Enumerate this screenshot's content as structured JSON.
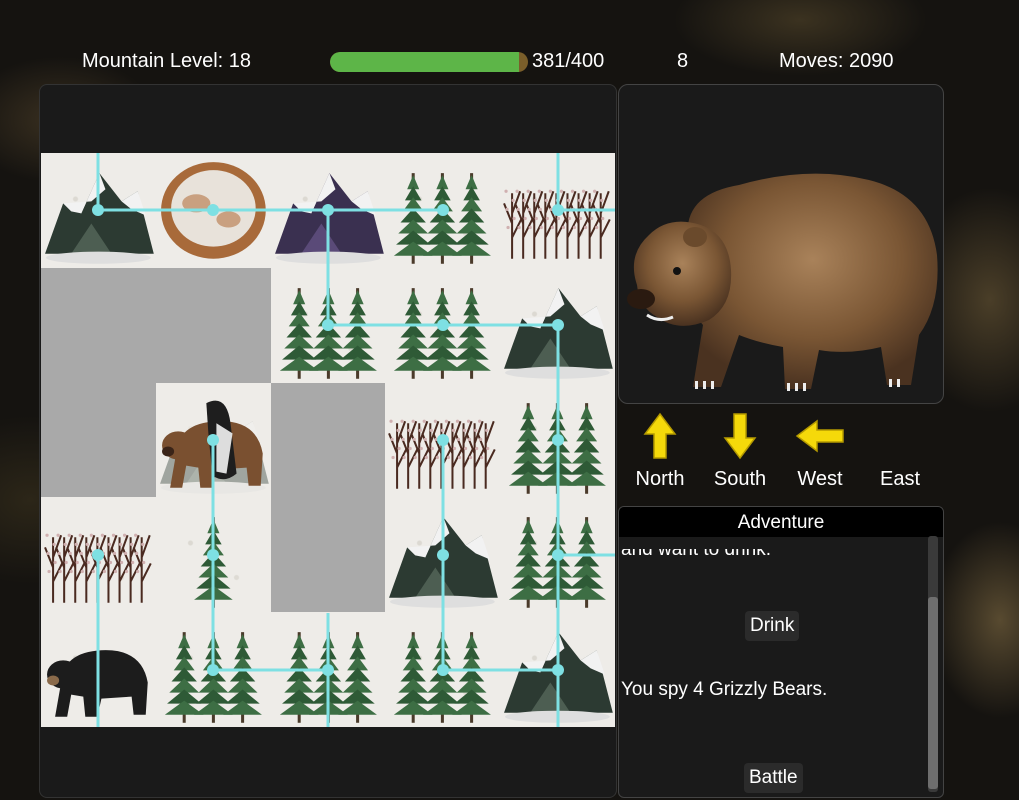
{
  "stats": {
    "level_label": "Mountain Level: 18",
    "hp_text": "381/400",
    "hp_fraction": 0.9525,
    "middle_value": "8",
    "moves_label": "Moves: 2090"
  },
  "colors": {
    "hp_fill": "#5db548",
    "path": "#7ee0e3",
    "arrow": "#f5d90a"
  },
  "grid": [
    [
      "snowy-mountain",
      "snowy-boulder",
      "dark-crag",
      "pine-trees",
      "bare-thicket"
    ],
    [
      "empty-gray",
      "empty-gray",
      "pine-trees",
      "pine-trees",
      "snowy-mountain"
    ],
    [
      "empty-gray",
      "bear-and-raven",
      "empty-gray",
      "bare-thicket",
      "pine-trees"
    ],
    [
      "bare-thicket",
      "pine-tree",
      "empty-gray",
      "snowy-mountain",
      "pine-trees"
    ],
    [
      "black-bear",
      "pine-trees",
      "pine-trees",
      "pine-trees",
      "snowy-mountain"
    ]
  ],
  "portrait": {
    "icon": "grizzly-bear"
  },
  "directions": [
    {
      "label": "North",
      "icon": "arrow-up"
    },
    {
      "label": "South",
      "icon": "arrow-down"
    },
    {
      "label": "West",
      "icon": "arrow-left"
    },
    {
      "label": "East",
      "icon": "none"
    }
  ],
  "adventure": {
    "title": "Adventure",
    "clipped_text": "and want to drink.",
    "drink_label": "Drink",
    "message": "You spy 4 Grizzly Bears.",
    "battle_label": "Battle",
    "scroll_fraction": 0.24
  }
}
